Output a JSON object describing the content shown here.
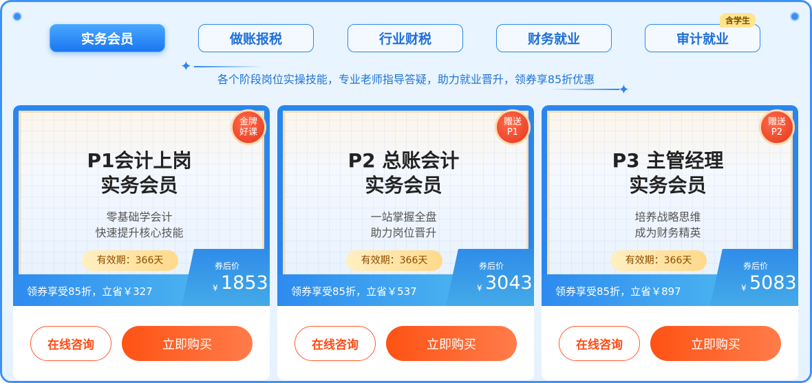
{
  "tabs": [
    {
      "label": "实务会员",
      "active": true
    },
    {
      "label": "做账报税",
      "active": false
    },
    {
      "label": "行业财税",
      "active": false
    },
    {
      "label": "财务就业",
      "active": false
    },
    {
      "label": "审计就业",
      "active": false,
      "tag": "含学生"
    }
  ],
  "subtitle": "各个阶段岗位实操技能，专业老师指导答疑，助力就业晋升，领券享85折优惠",
  "sparkle_icon": "✦",
  "cards": [
    {
      "title_line1": "P1会计上岗",
      "title_line2": "实务会员",
      "desc_line1": "零基础学会计",
      "desc_line2": "快速提升核心技能",
      "badge_line1": "金牌",
      "badge_line2": "好课",
      "validity": "有效期：366天",
      "savings": "领券享受85折，立省￥327",
      "price_label": "券后价",
      "currency": "¥",
      "price": "1853",
      "consult_label": "在线咨询",
      "buy_label": "立即购买"
    },
    {
      "title_line1": "P2 总账会计",
      "title_line2": "实务会员",
      "desc_line1": "一站掌握全盘",
      "desc_line2": "助力岗位晋升",
      "badge_line1": "赠送",
      "badge_line2": "P1",
      "validity": "有效期：366天",
      "savings": "领券享受85折，立省￥537",
      "price_label": "券后价",
      "currency": "¥",
      "price": "3043",
      "consult_label": "在线咨询",
      "buy_label": "立即购买"
    },
    {
      "title_line1": "P3 主管经理",
      "title_line2": "实务会员",
      "desc_line1": "培养战略思维",
      "desc_line2": "成为财务精英",
      "badge_line1": "赠送",
      "badge_line2": "P2",
      "validity": "有效期：366天",
      "savings": "领券享受85折，立省￥897",
      "price_label": "券后价",
      "currency": "¥",
      "price": "5083",
      "consult_label": "在线咨询",
      "buy_label": "立即购买"
    }
  ],
  "colors": {
    "accent_blue": "#2a86ee",
    "buy_orange": "#ff5214",
    "badge_red": "#e5371d"
  }
}
